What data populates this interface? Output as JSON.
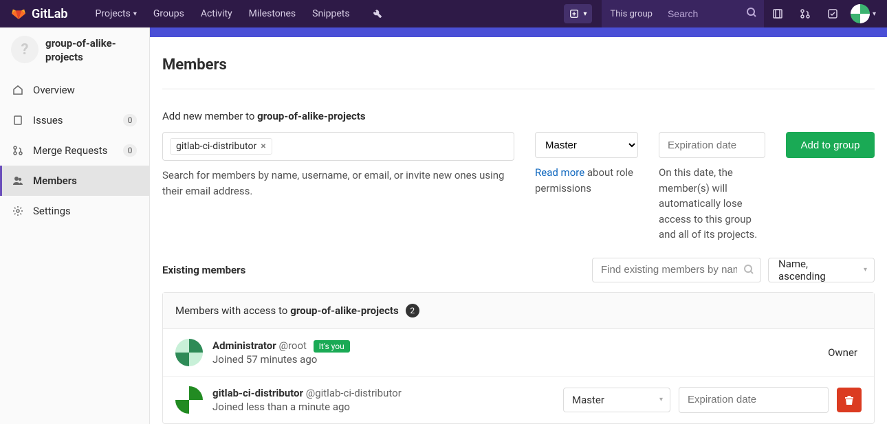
{
  "navbar": {
    "brand": "GitLab",
    "projects": "Projects",
    "groups": "Groups",
    "activity": "Activity",
    "milestones": "Milestones",
    "snippets": "Snippets",
    "scope": "This group",
    "search_placeholder": "Search"
  },
  "sidebar": {
    "group_name": "group-of-alike-projects",
    "group_avatar": "?",
    "items": [
      {
        "label": "Overview",
        "badge": null
      },
      {
        "label": "Issues",
        "badge": "0"
      },
      {
        "label": "Merge Requests",
        "badge": "0"
      },
      {
        "label": "Members",
        "badge": null
      },
      {
        "label": "Settings",
        "badge": null
      }
    ]
  },
  "page": {
    "title": "Members",
    "add_prefix": "Add new member to ",
    "group_name": "group-of-alike-projects",
    "member_token": "gitlab-ci-distributor",
    "member_help": "Search for members by name, username, or email, or invite new ones using their email address.",
    "role_selected": "Master",
    "role_help_link": "Read more",
    "role_help_rest": " about role permissions",
    "expiration_placeholder": "Expiration date",
    "expiration_help": "On this date, the member(s) will automatically lose access to this group and all of its projects.",
    "add_button": "Add to group"
  },
  "existing": {
    "heading": "Existing members",
    "find_placeholder": "Find existing members by name",
    "sort": "Name, ascending"
  },
  "panel": {
    "head_prefix": "Members with access to ",
    "group_name": "group-of-alike-projects",
    "count": "2"
  },
  "members": [
    {
      "name": "Administrator",
      "handle": "@root",
      "you": "It's you",
      "joined": "Joined 57 minutes ago",
      "role_text": "Owner",
      "editable": false
    },
    {
      "name": "gitlab-ci-distributor",
      "handle": "@gitlab-ci-distributor",
      "you": null,
      "joined": "Joined less than a minute ago",
      "role_text": "Master",
      "editable": true,
      "expiration_placeholder": "Expiration date"
    }
  ]
}
